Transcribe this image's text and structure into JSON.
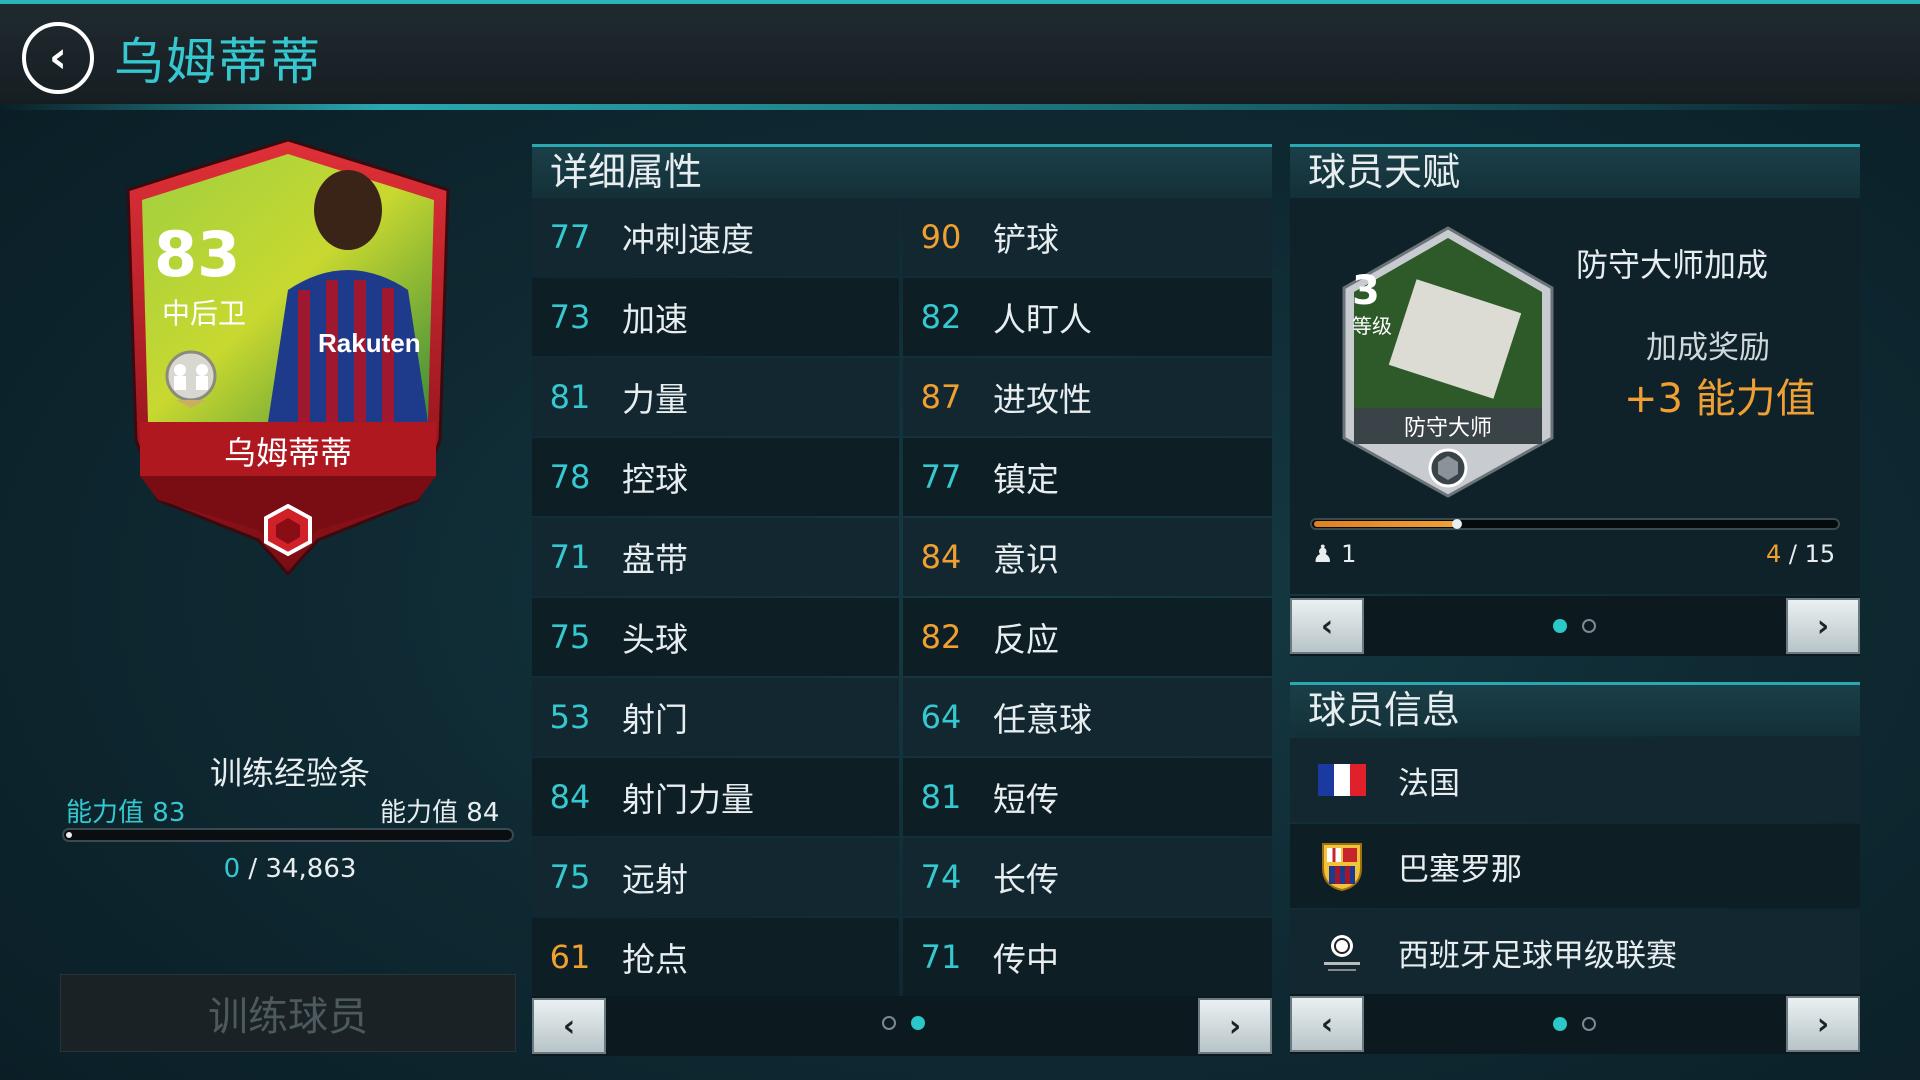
{
  "header": {
    "back_icon": "chevron-left-icon",
    "title": "乌姆蒂蒂"
  },
  "card": {
    "rating": "83",
    "position": "中后卫",
    "name": "乌姆蒂蒂",
    "sponsor": "Rakuten",
    "accent": "#c8242c"
  },
  "training": {
    "title": "训练经验条",
    "current_label": "能力值",
    "current_value": "83",
    "next_label": "能力值",
    "next_value": "84",
    "progress_current": "0",
    "progress_sep": "/",
    "progress_total": "34,863",
    "progress_fraction": 0.0,
    "button_label": "训练球员"
  },
  "stats": {
    "title": "详细属性",
    "left": [
      {
        "value": "77",
        "name": "冲刺速度",
        "color": "teal"
      },
      {
        "value": "73",
        "name": "加速",
        "color": "teal"
      },
      {
        "value": "81",
        "name": "力量",
        "color": "teal"
      },
      {
        "value": "78",
        "name": "控球",
        "color": "teal"
      },
      {
        "value": "71",
        "name": "盘带",
        "color": "teal"
      },
      {
        "value": "75",
        "name": "头球",
        "color": "teal"
      },
      {
        "value": "53",
        "name": "射门",
        "color": "teal"
      },
      {
        "value": "84",
        "name": "射门力量",
        "color": "teal"
      },
      {
        "value": "75",
        "name": "远射",
        "color": "teal"
      },
      {
        "value": "61",
        "name": "抢点",
        "color": "orange"
      }
    ],
    "right": [
      {
        "value": "90",
        "name": "铲球",
        "color": "orange"
      },
      {
        "value": "82",
        "name": "人盯人",
        "color": "teal"
      },
      {
        "value": "87",
        "name": "进攻性",
        "color": "orange"
      },
      {
        "value": "77",
        "name": "镇定",
        "color": "teal"
      },
      {
        "value": "84",
        "name": "意识",
        "color": "orange"
      },
      {
        "value": "82",
        "name": "反应",
        "color": "orange"
      },
      {
        "value": "64",
        "name": "任意球",
        "color": "teal"
      },
      {
        "value": "81",
        "name": "短传",
        "color": "teal"
      },
      {
        "value": "74",
        "name": "长传",
        "color": "teal"
      },
      {
        "value": "71",
        "name": "传中",
        "color": "teal"
      }
    ],
    "page": 2,
    "pages": 2
  },
  "talent": {
    "title": "球员天赋",
    "level_number": "3",
    "level_label": "等级",
    "badge_label": "防守大师",
    "name": "防守大师加成",
    "bonus_label": "加成奖励",
    "bonus_value": "+3 能力值",
    "people_count": "1",
    "progress_current": "4",
    "progress_sep": "/",
    "progress_total": "15",
    "progress_fraction": 0.27,
    "page": 1,
    "pages": 2
  },
  "info": {
    "title": "球员信息",
    "nation": "法国",
    "club": "巴塞罗那",
    "league": "西班牙足球甲级联赛",
    "page": 1,
    "pages": 2
  },
  "colors": {
    "teal": "#36c8d0",
    "orange": "#f0a032"
  }
}
